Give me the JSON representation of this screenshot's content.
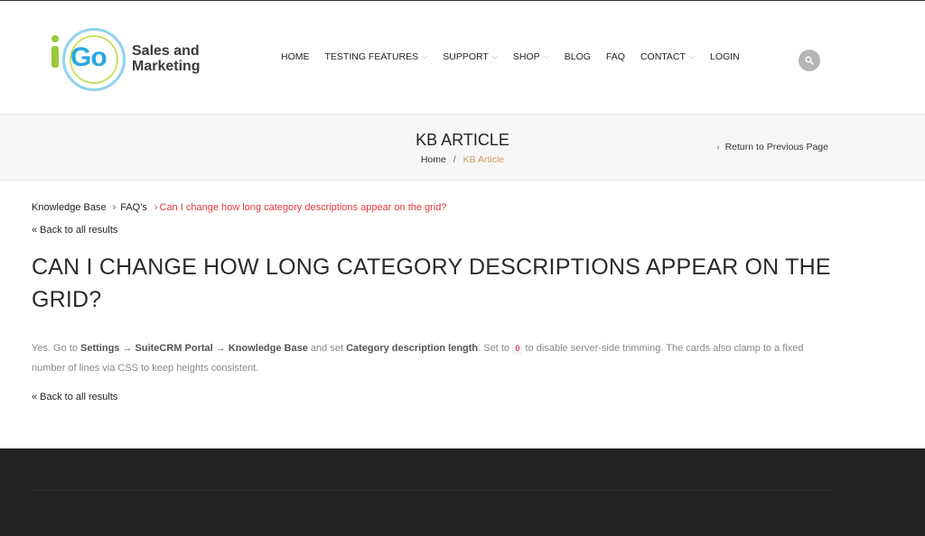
{
  "logo": {
    "mark_letters": "Go",
    "line1": "Sales and",
    "line2": "Marketing",
    "colors": {
      "green": "#9cc83a",
      "blue": "#2aa7df"
    }
  },
  "nav": {
    "items": [
      {
        "label": "HOME",
        "has_dropdown": false
      },
      {
        "label": "TESTING FEATURES",
        "has_dropdown": true
      },
      {
        "label": "SUPPORT",
        "has_dropdown": true
      },
      {
        "label": "SHOP",
        "has_dropdown": true
      },
      {
        "label": "BLOG",
        "has_dropdown": false
      },
      {
        "label": "FAQ",
        "has_dropdown": false
      },
      {
        "label": "CONTACT",
        "has_dropdown": true
      },
      {
        "label": "LOGIN",
        "has_dropdown": false
      }
    ],
    "search_icon": "search-icon"
  },
  "titlebar": {
    "title": "KB ARTICLE",
    "breadcrumb_home": "Home",
    "breadcrumb_sep": "/",
    "breadcrumb_current": "KB Article",
    "return_label": "Return to Previous Page"
  },
  "article": {
    "crumb_kb": "Knowledge Base",
    "crumb_faqs": "FAQ's",
    "crumb_current": "Can I change how long category descriptions appear on the grid?",
    "crumb_sep": "›",
    "back_label": "« Back to all results",
    "title": "CAN I CHANGE HOW LONG CATEGORY DESCRIPTIONS APPEAR ON THE GRID?",
    "body": {
      "p1": "Yes. Go to ",
      "b1": "Settings → SuiteCRM Portal → Knowledge Base",
      "p2": " and set ",
      "b2": "Category description length",
      "p3": ". Set to ",
      "code": "0",
      "p4": " to disable server-side trimming. The cards also clamp to a fixed number of lines via CSS to keep heights consistent."
    }
  },
  "colors": {
    "accent_red": "#e03a3a",
    "breadcrumb_gold": "#c8a064",
    "footer_bg": "#222222"
  }
}
